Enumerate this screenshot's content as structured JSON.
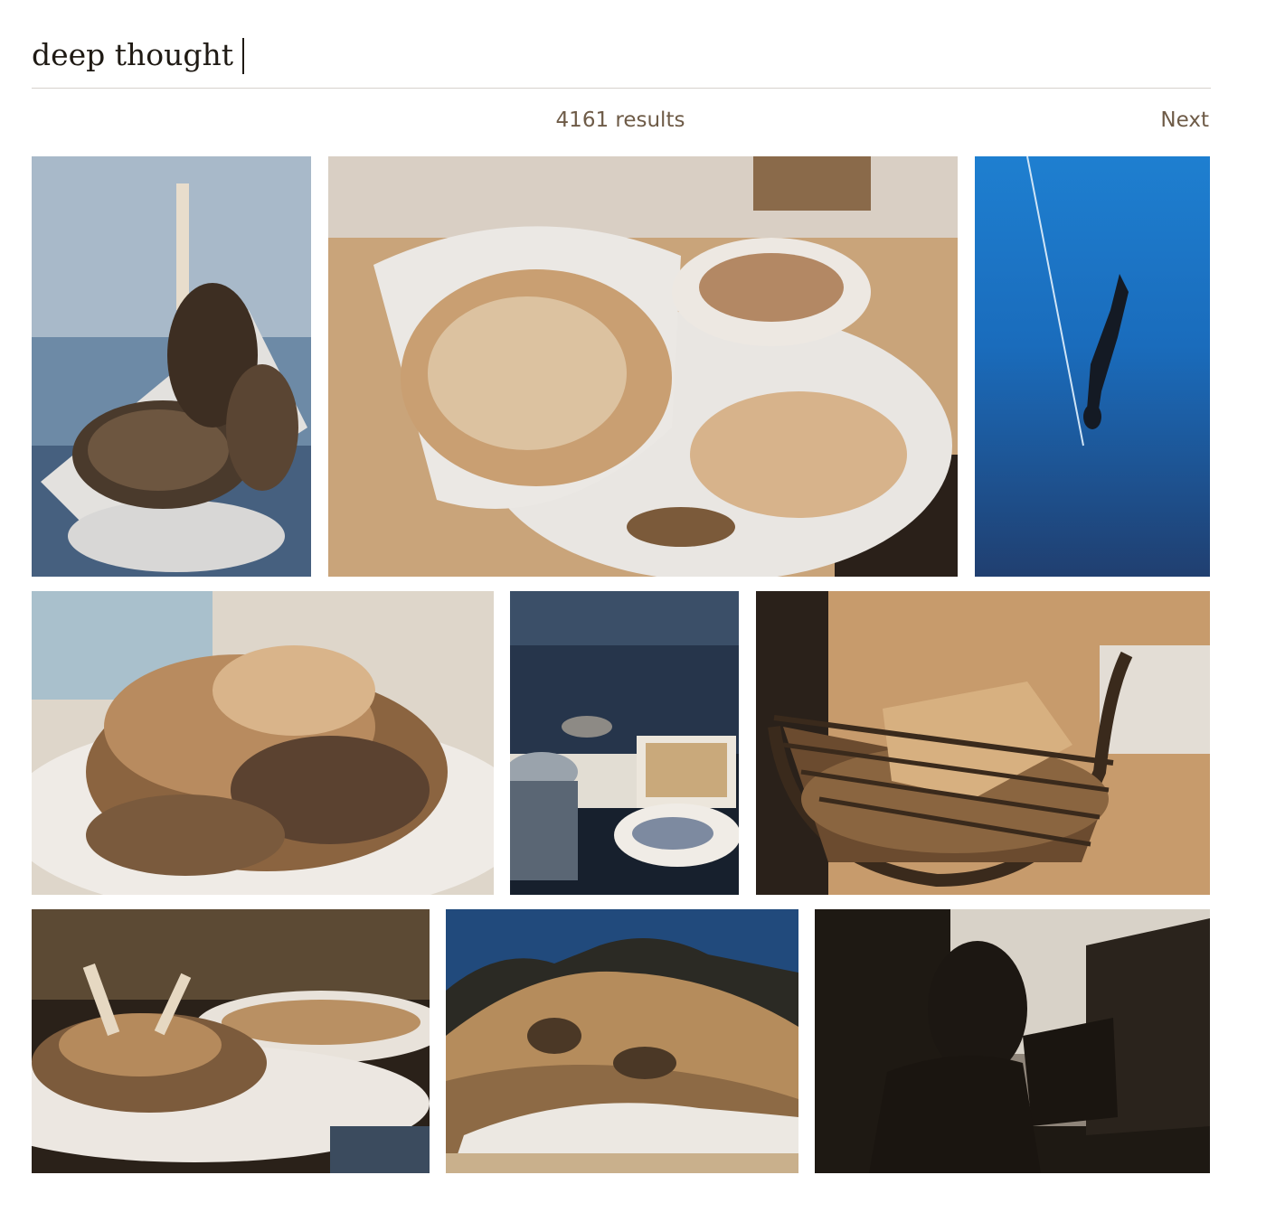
{
  "search": {
    "value": "deep thought",
    "placeholder": "Search"
  },
  "results": {
    "count_label": "4161 results",
    "next_label": "Next"
  },
  "palette": {
    "tan": "#b98f62",
    "cream": "#e6ddd2",
    "dark": "#231c16",
    "ocean_blue": "#1e6fc0",
    "deep_blue": "#1c4478",
    "slate_blue": "#3a5575"
  },
  "grid": {
    "photos": [
      {
        "subject": "plated meat dish with bones on square plate"
      },
      {
        "subject": "sandwich wrapped in paper with soup cup and fries"
      },
      {
        "subject": "freediver descending along rope in blue water"
      },
      {
        "subject": "grilled fish topped with diced fruit salsa"
      },
      {
        "subject": "buffet trays and bowl on a dark table"
      },
      {
        "subject": "bread in a wicker basket"
      },
      {
        "subject": "lamb chops on white plates"
      },
      {
        "subject": "rocky hill with trees under blue sky"
      },
      {
        "subject": "silhouette of person looking at open laptop"
      }
    ]
  }
}
